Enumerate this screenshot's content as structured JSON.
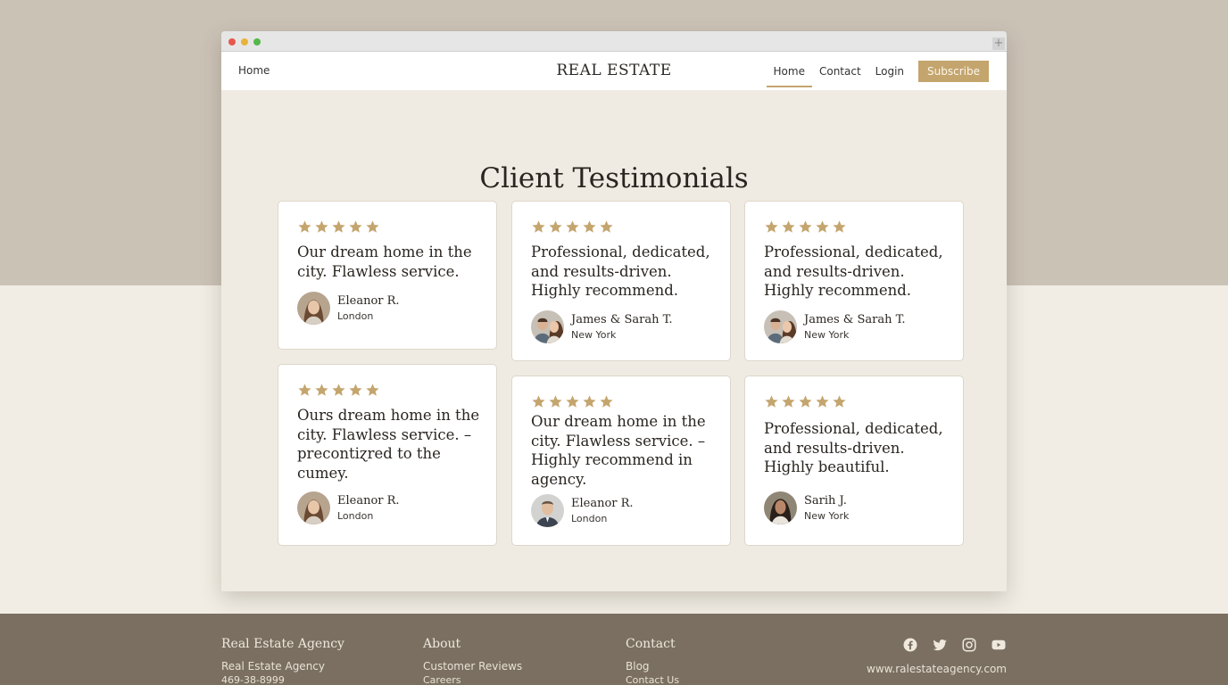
{
  "window": {
    "add_tab_icon": "plus-icon"
  },
  "nav": {
    "left_link": "Home",
    "brand": "REAL ESTATE",
    "links": [
      "Home",
      "Contact",
      "Login"
    ],
    "subscribe": "Subscribe",
    "accent_color": "#c4a56e"
  },
  "page": {
    "title": "Client Testimonials"
  },
  "testimonials": [
    {
      "rating": 5,
      "quote": "Our dream home in the city. Flawless service.",
      "name": "Eleanor R.",
      "location": "London"
    },
    {
      "rating": 5,
      "quote": "Professional, dedicated, and results-driven. Highly recommend.",
      "name": "James & Sarah T.",
      "location": "New York"
    },
    {
      "rating": 5,
      "quote": "Professional, dedicated, and results-driven. Highly recommend.",
      "name": "James & Sarah T.",
      "location": "New York"
    },
    {
      "rating": 5,
      "quote": "Ourꜱ dream home in the city. Flawless service. – precontiɀred to the cumey.",
      "name": "Eleanor R.",
      "location": "London"
    },
    {
      "rating": 5,
      "quote": "Our dream home in the city. Flawless service. – Highly recommend in agency.",
      "name": "Eleanor R.",
      "location": "London"
    },
    {
      "rating": 5,
      "quote": "Professional, dedicated, and results-driven. Highly beautiful.",
      "name": "Sarih J.",
      "location": "New York"
    }
  ],
  "footer": {
    "col1": {
      "heading": "Real Estate Agency",
      "item1": "Real Estate Agency",
      "item2": "469-38-8999"
    },
    "col2": {
      "heading": "About",
      "item1": "Customer Reviews",
      "item2": "Careers"
    },
    "col3": {
      "heading": "Contact",
      "item1": "Blog",
      "item2": "Contact Us"
    },
    "social_icons": [
      "facebook-icon",
      "twitter-icon",
      "instagram-icon",
      "youtube-icon"
    ],
    "website": "www.ralestateagency.com"
  }
}
